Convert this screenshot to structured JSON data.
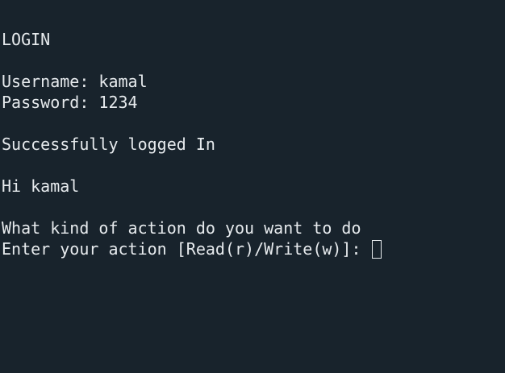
{
  "terminal": {
    "lines": [
      "LOGIN",
      "",
      "Username: kamal",
      "Password: 1234",
      "",
      "Successfully logged In",
      "",
      "Hi kamal",
      "",
      "What kind of action do you want to do"
    ],
    "prompt": "Enter your action [Read(r)/Write(w)]: "
  }
}
